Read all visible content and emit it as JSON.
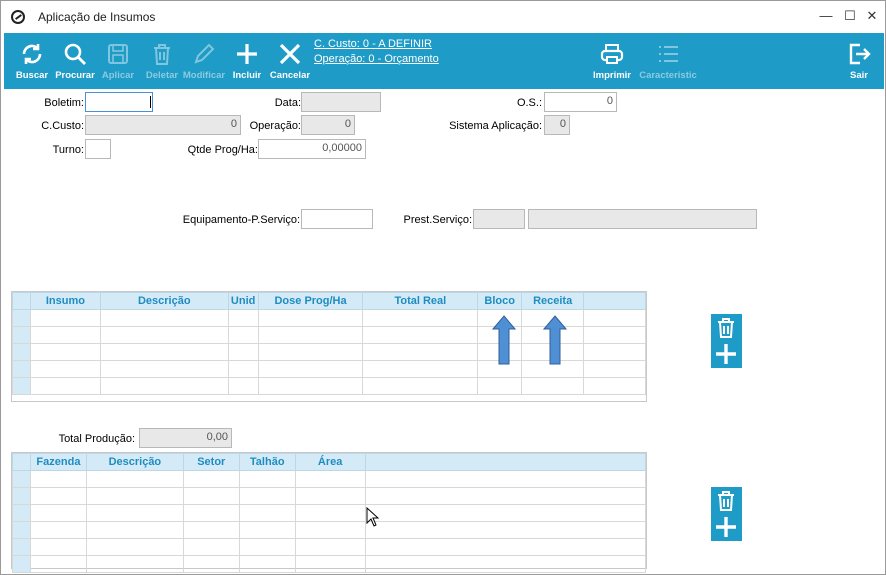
{
  "window": {
    "title": "Aplicação de Insumos"
  },
  "toolbar": {
    "buscar": "Buscar",
    "procurar": "Procurar",
    "aplicar": "Aplicar",
    "deletar": "Deletar",
    "modificar": "Modificar",
    "incluir": "Incluir",
    "cancelar": "Cancelar",
    "imprimir": "Imprimir",
    "caracteristic": "Caracteristic",
    "sair": "Sair",
    "link_custo": "C. Custo: 0 - A DEFINIR",
    "link_operacao": "Operação: 0 - Orçamento"
  },
  "form": {
    "boletim_label": "Boletim:",
    "boletim_value": "",
    "data_label": "Data:",
    "data_value": "",
    "os_label": "O.S.:",
    "os_value": "0",
    "ccusto_label": "C.Custo:",
    "ccusto_value": "0",
    "operacao_label": "Operação:",
    "operacao_value": "0",
    "sistema_label": "Sistema Aplicação:",
    "sistema_value": "0",
    "turno_label": "Turno:",
    "turno_value": "",
    "qtde_label": "Qtde Prog/Ha:",
    "qtde_value": "0,00000",
    "equip_label": "Equipamento-P.Serviço:",
    "equip_value": "",
    "prest_label": "Prest.Serviço:",
    "prest_value": "",
    "prest_desc": "",
    "total_label": "Total Produção:",
    "total_value": "0,00"
  },
  "grid1": {
    "columns": [
      "Insumo",
      "Descrição",
      "Unid",
      "Dose Prog/Ha",
      "Total Real",
      "Bloco",
      "Receita"
    ]
  },
  "grid2": {
    "columns": [
      "Fazenda",
      "Descrição",
      "Setor",
      "Talhão",
      "Área"
    ]
  },
  "colors": {
    "accent": "#1e9bc6",
    "header_bg": "#d4ebf7",
    "header_text": "#1e8cc0",
    "arrow": "#4f8fd4"
  }
}
